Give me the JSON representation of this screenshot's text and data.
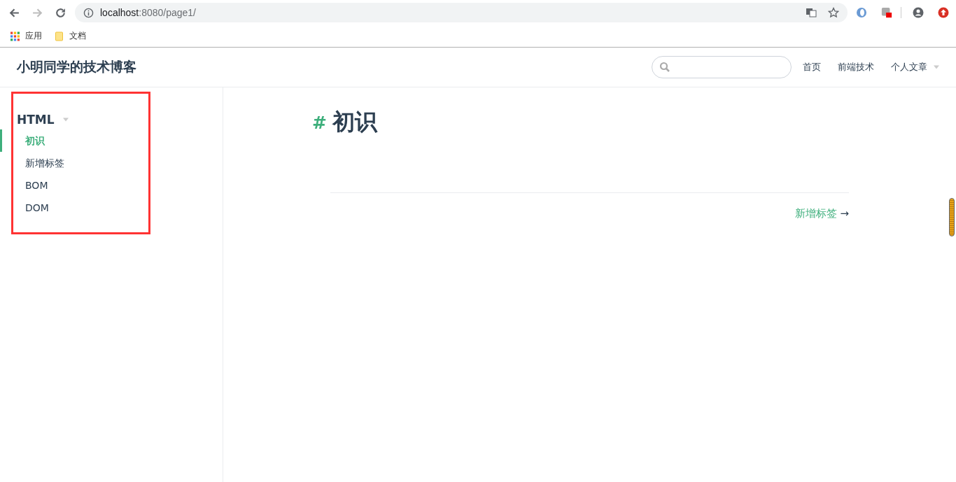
{
  "browser": {
    "url_host": "localhost",
    "url_rest": ":8080/page1/",
    "bookmarks": [
      {
        "label": "应用",
        "kind": "apps"
      },
      {
        "label": "文档",
        "kind": "folder"
      }
    ]
  },
  "site": {
    "title": "小明同学的技术博客",
    "search_field": true,
    "nav": [
      {
        "label": "首页",
        "dropdown": false
      },
      {
        "label": "前端技术",
        "dropdown": false
      },
      {
        "label": "个人文章",
        "dropdown": true
      }
    ]
  },
  "sidebar": {
    "group": "HTML",
    "expanded": true,
    "items": [
      {
        "label": "初识",
        "selected": true
      },
      {
        "label": "新增标签",
        "selected": false
      },
      {
        "label": "BOM",
        "selected": false
      },
      {
        "label": "DOM",
        "selected": false
      }
    ]
  },
  "content": {
    "anchor": "#",
    "heading": "初识",
    "next": {
      "label": "新增标签",
      "arrow": "→"
    }
  }
}
